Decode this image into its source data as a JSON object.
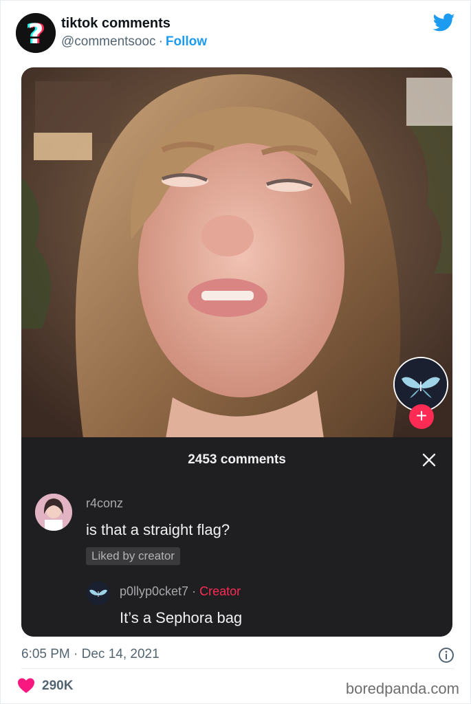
{
  "tweet": {
    "display_name": "tiktok comments",
    "handle": "@commentsooc",
    "separator": "·",
    "follow_label": "Follow",
    "timestamp": "6:05 PM · Dec 14, 2021",
    "likes": "290K"
  },
  "tiktok": {
    "comments_count": "2453 comments",
    "plus_label": "+",
    "comment": {
      "user": "r4conz",
      "text": "is that a straight flag?",
      "badge": "Liked by creator"
    },
    "reply": {
      "user": "p0llyp0cket7",
      "separator": "·",
      "tag": "Creator",
      "text": "It’s a Sephora bag"
    }
  },
  "watermark": "boredpanda.com",
  "colors": {
    "twitter_blue": "#1d9bf0",
    "like_pink": "#f91880",
    "tiktok_red": "#fe2c55",
    "panel_bg": "#1f1f21"
  },
  "icons": [
    "question-logo-icon",
    "twitter-bird-icon",
    "close-icon",
    "plus-icon",
    "info-icon",
    "heart-icon"
  ]
}
